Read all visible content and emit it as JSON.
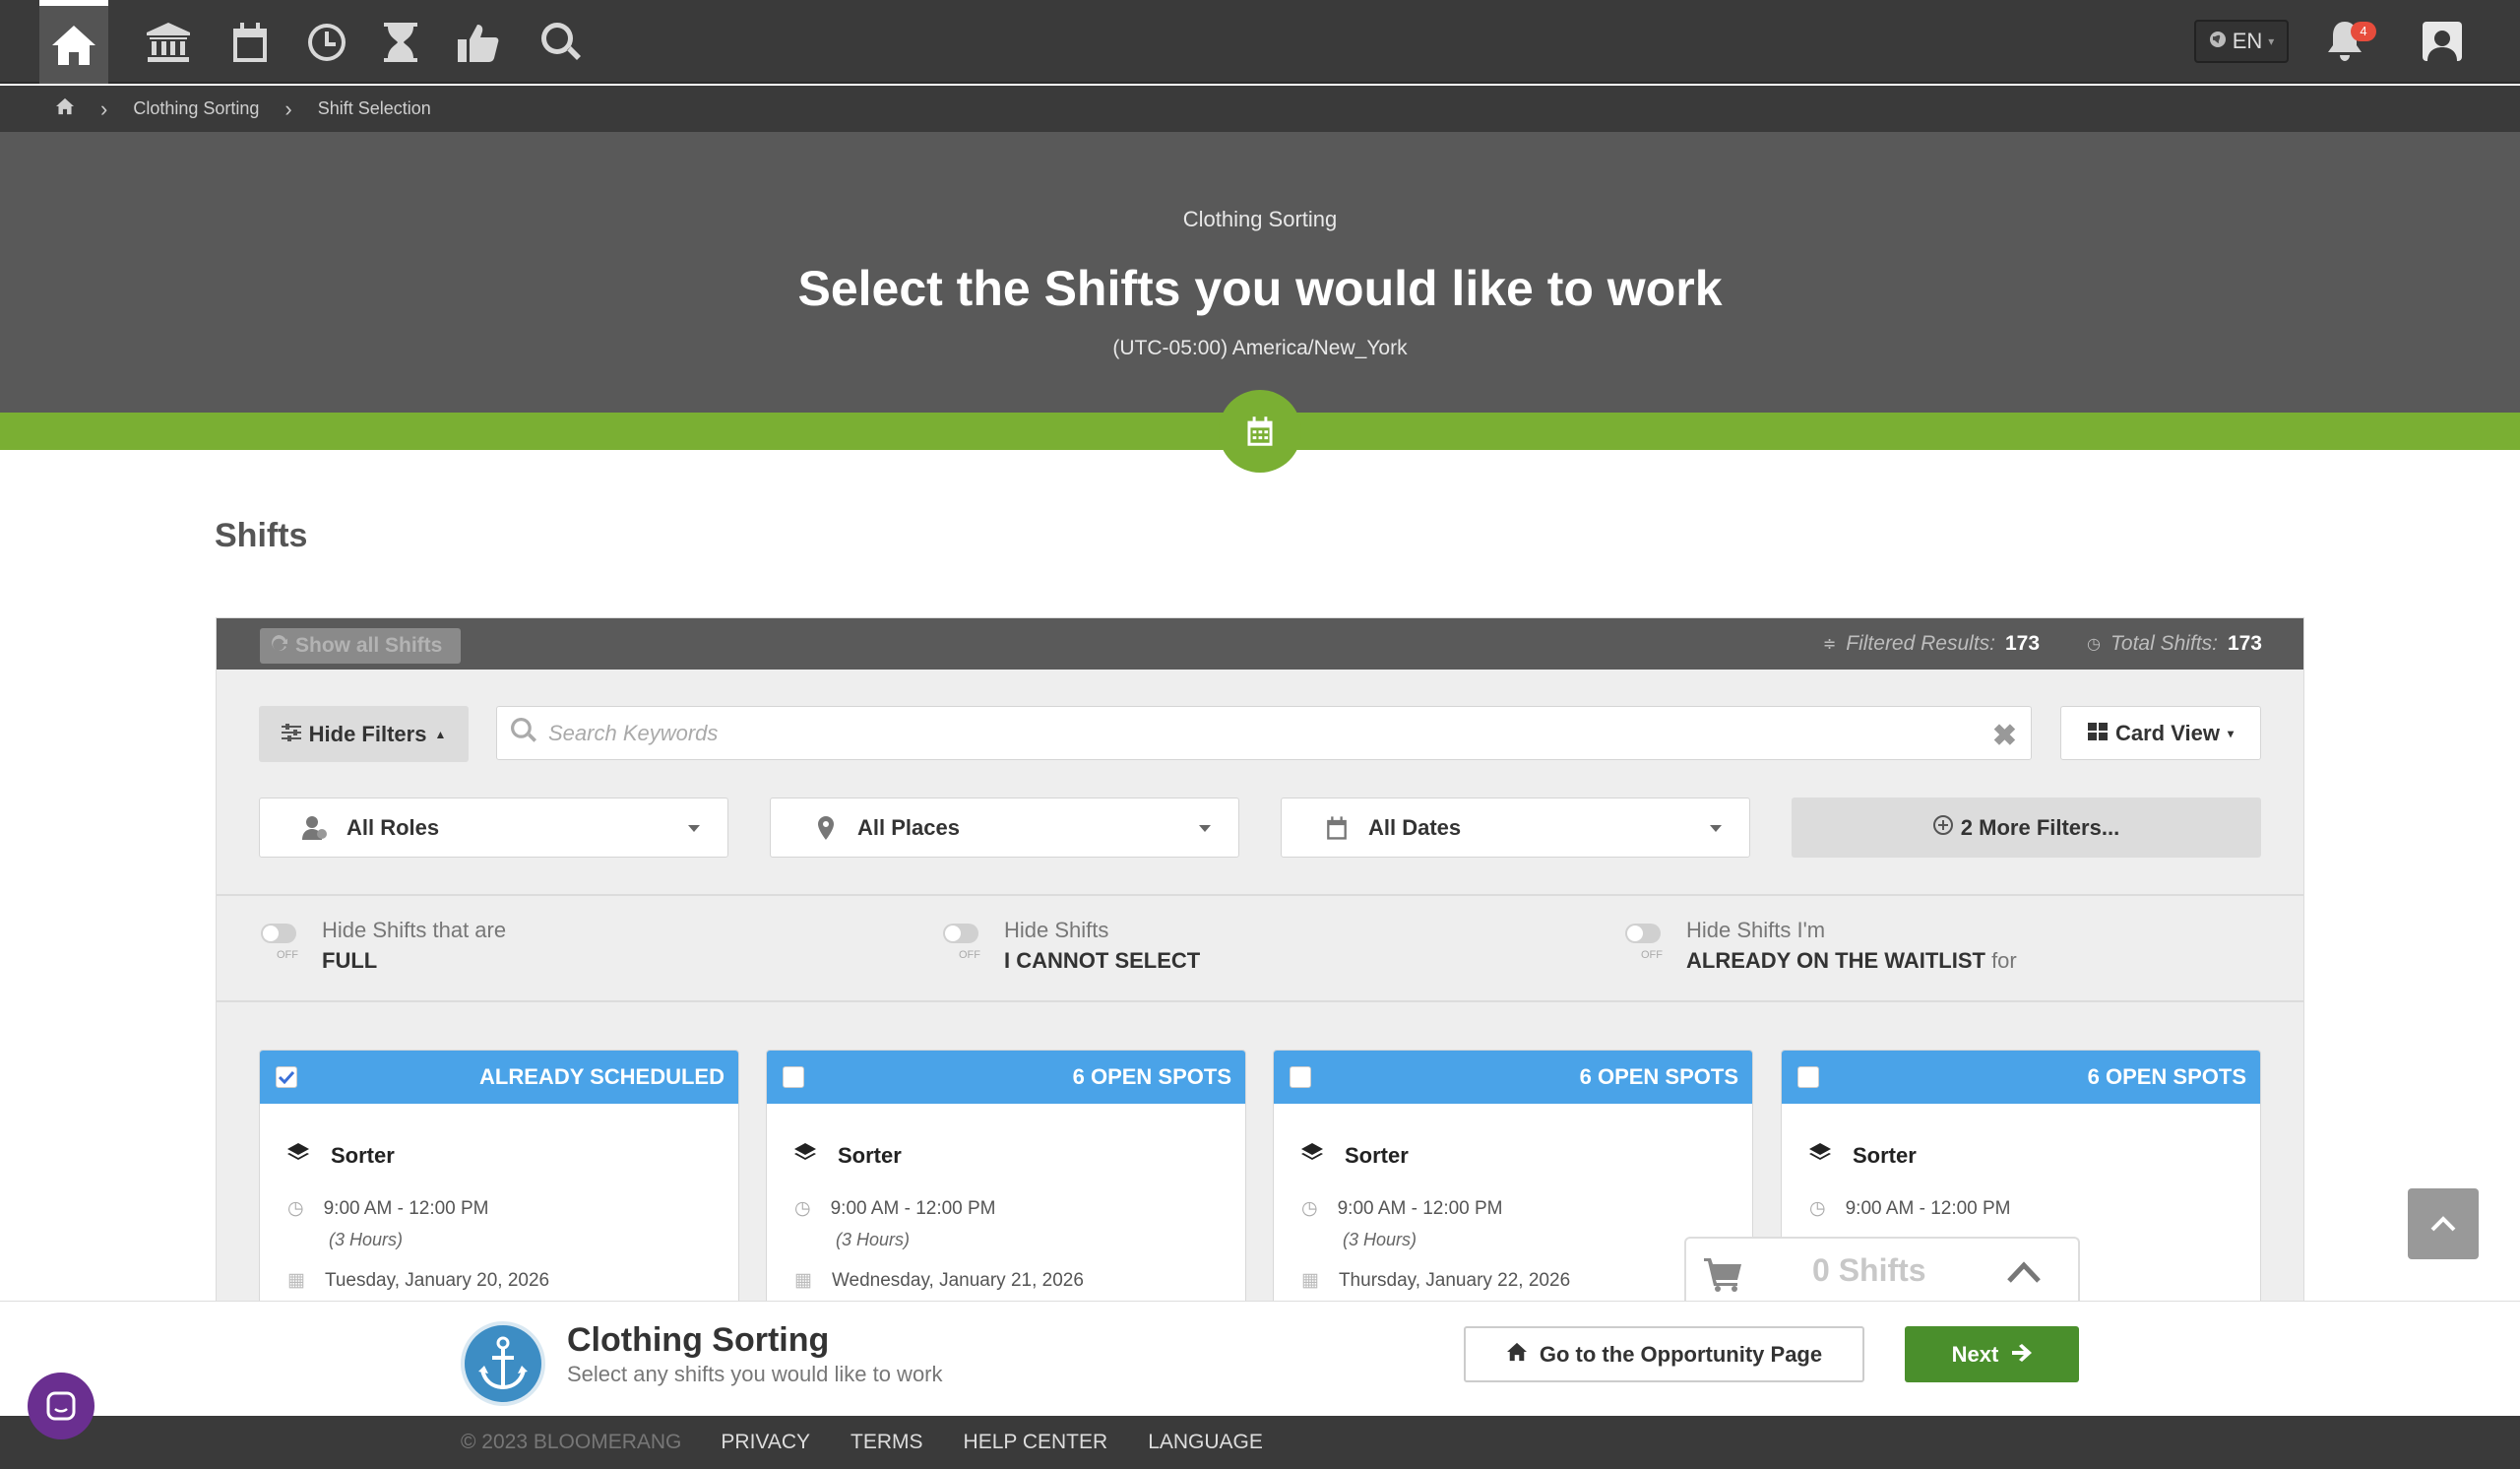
{
  "nav": {
    "icons": [
      "home-icon",
      "bank-icon",
      "calendar-icon",
      "clock-icon",
      "hourglass-icon",
      "thumbs-up-icon",
      "search-icon"
    ],
    "language": "EN",
    "notification_count": "4"
  },
  "breadcrumb": {
    "items": [
      "Clothing Sorting",
      "Shift Selection"
    ]
  },
  "hero": {
    "subtitle": "Clothing Sorting",
    "title": "Select the Shifts you would like to work",
    "timezone": "(UTC-05:00) America/New_York"
  },
  "main": {
    "section_title": "Shifts",
    "show_all_label": "Show all Shifts",
    "filtered_label": "Filtered Results:",
    "filtered_count": "173",
    "total_label": "Total Shifts:",
    "total_count": "173",
    "hide_filters_label": "Hide Filters",
    "search_placeholder": "Search Keywords",
    "card_view_label": "Card View",
    "filters": {
      "roles": "All Roles",
      "places": "All Places",
      "dates": "All Dates",
      "more": "2 More Filters..."
    },
    "toggles": [
      {
        "line1": "Hide Shifts that are",
        "line2": "FULL",
        "suffix": "",
        "state": "OFF"
      },
      {
        "line1": "Hide Shifts",
        "line2": "I CANNOT SELECT",
        "suffix": "",
        "state": "OFF"
      },
      {
        "line1": "Hide Shifts I'm",
        "line2": "ALREADY ON THE WAITLIST",
        "suffix": "for",
        "state": "OFF"
      }
    ],
    "cards": [
      {
        "status": "ALREADY SCHEDULED",
        "checked": true,
        "role": "Sorter",
        "time": "9:00 AM - 12:00 PM",
        "duration": "(3 Hours)",
        "date": "Tuesday, January 20, 2026"
      },
      {
        "status": "6 OPEN SPOTS",
        "checked": false,
        "role": "Sorter",
        "time": "9:00 AM - 12:00 PM",
        "duration": "(3 Hours)",
        "date": "Wednesday, January 21, 2026"
      },
      {
        "status": "6 OPEN SPOTS",
        "checked": false,
        "role": "Sorter",
        "time": "9:00 AM - 12:00 PM",
        "duration": "(3 Hours)",
        "date": "Thursday, January 22, 2026"
      },
      {
        "status": "6 OPEN SPOTS",
        "checked": false,
        "role": "Sorter",
        "time": "9:00 AM - 12:00 PM",
        "duration": "(3 Hours)",
        "date": ""
      }
    ]
  },
  "cart": {
    "label": "0 Shifts"
  },
  "bottom_bar": {
    "title": "Clothing Sorting",
    "subtitle": "Select any shifts you would like to work",
    "opportunity_button": "Go to the Opportunity Page",
    "next_button": "Next"
  },
  "footer": {
    "copyright": "© 2023 BLOOMERANG",
    "links": [
      "PRIVACY",
      "TERMS",
      "HELP CENTER",
      "LANGUAGE"
    ]
  },
  "colors": {
    "accent_green": "#7aaf33",
    "card_blue": "#4aa3e8",
    "next_green": "#4a8f2c"
  }
}
